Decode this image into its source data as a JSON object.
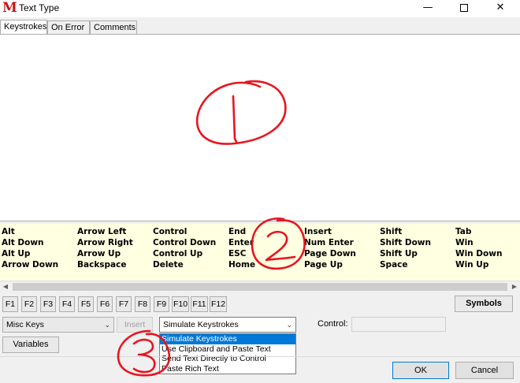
{
  "window": {
    "app_icon_letter": "M",
    "title": "Text Type",
    "minimize_glyph": "—",
    "close_glyph": "✕"
  },
  "tabs": [
    {
      "label": "Keystrokes",
      "active": true
    },
    {
      "label": "On Error",
      "active": false
    },
    {
      "label": "Comments",
      "active": false
    }
  ],
  "special_keys": {
    "columns": [
      [
        "Alt",
        "Alt Down",
        "Alt Up",
        "Arrow Down"
      ],
      [
        "Arrow Left",
        "Arrow Right",
        "Arrow Up",
        "Backspace"
      ],
      [
        "Control",
        "Control Down",
        "Control Up",
        "Delete"
      ],
      [
        "End",
        "Enter",
        "ESC",
        "Home"
      ],
      [
        "Insert",
        "Num Enter",
        "Page Down",
        "Page Up"
      ],
      [
        "Shift",
        "Shift Down",
        "Shift Up",
        "Space"
      ],
      [
        "Tab",
        "Win",
        "Win Down",
        "Win Up"
      ]
    ]
  },
  "function_keys": [
    "F1",
    "F2",
    "F3",
    "F4",
    "F5",
    "F6",
    "F7",
    "F8",
    "F9",
    "F10",
    "F11",
    "F12"
  ],
  "toolbar": {
    "symbols_label": "Symbols",
    "misc_keys_value": "Misc Keys",
    "insert_label": "Insert",
    "method_value": "Simulate Keystrokes",
    "control_label": "Control:",
    "variables_label": "Variables"
  },
  "method_options": [
    "Simulate Keystrokes",
    "Use Clipboard and Paste Text",
    "Send Text Directly to Control",
    "Paste Rich Text"
  ],
  "footer": {
    "ok_label": "OK",
    "cancel_label": "Cancel"
  },
  "colors": {
    "keys_panel_bg": "#ffffe1",
    "selection": "#0078d7",
    "annotation_red": "#e8141e"
  }
}
